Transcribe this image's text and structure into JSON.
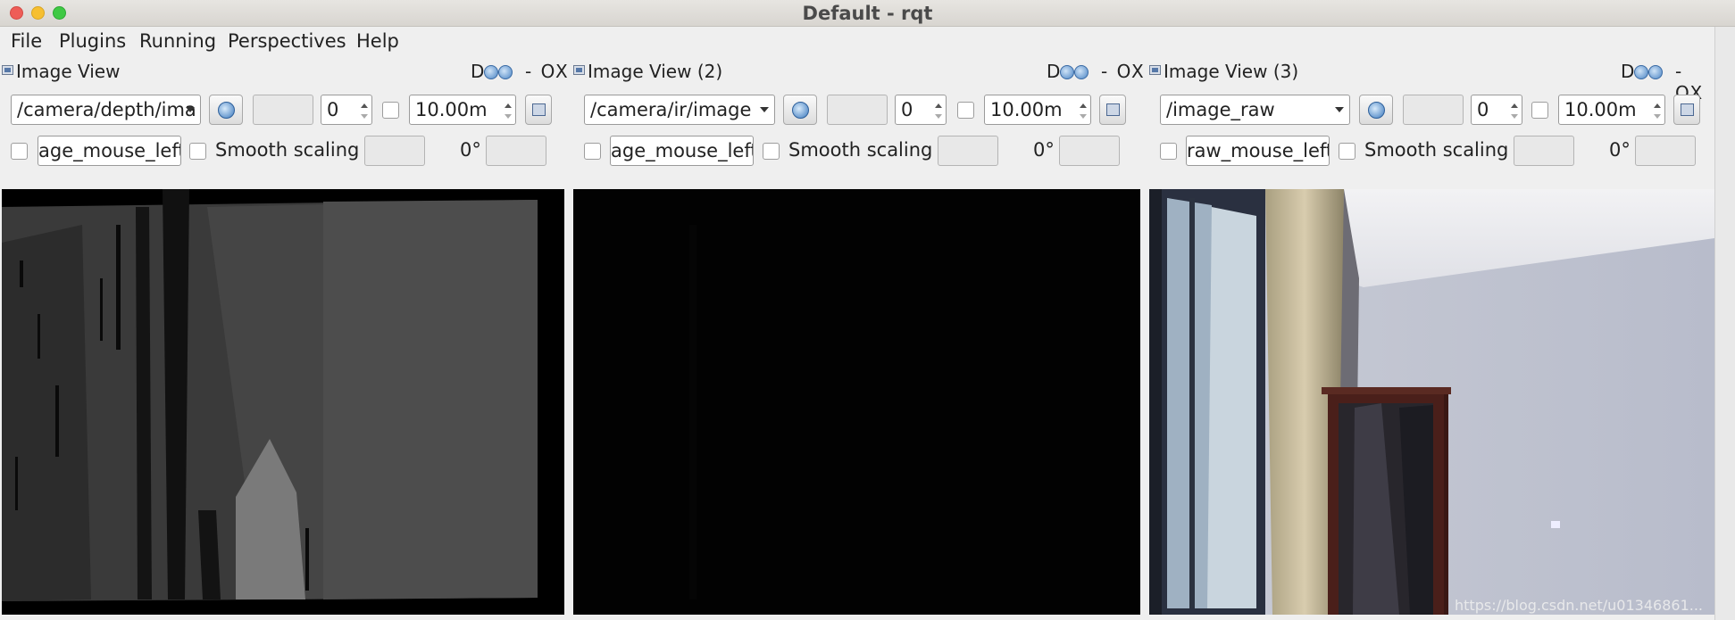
{
  "window": {
    "title": "Default - rqt"
  },
  "menu": [
    {
      "label": "File"
    },
    {
      "label": "Plugins"
    },
    {
      "label": "Running"
    },
    {
      "label": "Perspectives"
    },
    {
      "label": "Help"
    }
  ],
  "panels": [
    {
      "title": "Image View",
      "header_right": "D",
      "header_controls": "- OX",
      "topic": "/camera/depth/ima",
      "min_value": "0",
      "max_value": "10.00m",
      "mouse_topic": "age_mouse_left",
      "smooth_label": "Smooth scaling",
      "rotation": "0°"
    },
    {
      "title": "Image View (2)",
      "header_right": "D",
      "header_controls": "- OX",
      "topic": "/camera/ir/image",
      "min_value": "0",
      "max_value": "10.00m",
      "mouse_topic": "age_mouse_left",
      "smooth_label": "Smooth scaling",
      "rotation": "0°"
    },
    {
      "title": "Image View (3)",
      "header_right": "D",
      "header_controls": "- OX",
      "topic": "/image_raw",
      "min_value": "0",
      "max_value": "10.00m",
      "mouse_topic": "raw_mouse_left",
      "smooth_label": "Smooth scaling",
      "rotation": "0°"
    }
  ],
  "watermark": "https://blog.csdn.net/u01346861..."
}
